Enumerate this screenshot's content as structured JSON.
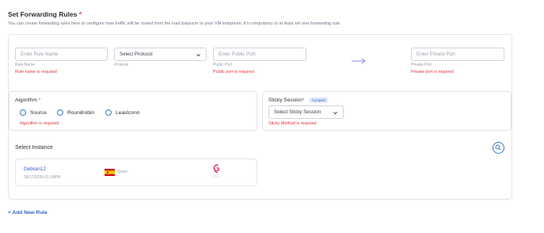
{
  "header": {
    "title": "Set Forwarding Rules",
    "required_mark": "*",
    "description": "You can create forwarding rules here to configure how traffic will be routed from the load balancer to your VM instances. It's compulsory to at least set one forwarding rule."
  },
  "rule": {
    "rule_name": {
      "placeholder": "Enter Rule Name",
      "label": "Rule Name",
      "error": "Rule name is required"
    },
    "protocol": {
      "value": "Select Protocol",
      "label": "Protocol"
    },
    "public_port": {
      "placeholder": "Enter Public Port",
      "label": "Public Port",
      "error": "Public port is required"
    },
    "private_port": {
      "placeholder": "Enter Private Port",
      "label": "Private Port",
      "error": "Private port is required"
    }
  },
  "algorithm": {
    "title": "Algorithm",
    "required_mark": "*",
    "options": [
      "Source",
      "Roundrobin",
      "Leastconn"
    ],
    "error": "Algorithm is required"
  },
  "sticky": {
    "title": "Sticky Session",
    "required_mark": "*",
    "badge": "Compare",
    "value": "Select Sticky Session",
    "error": "Sticky Method is required"
  },
  "instance": {
    "section_title": "Select Instance",
    "name": "Debian12",
    "date": "08/17/2024 01:34PM",
    "region": "Spain",
    "flag_icon": "spain-flag-icon",
    "os_icon": "debian-logo-icon"
  },
  "add_rule": "+ Add New Rule",
  "colors": {
    "accent": "#3c78c8",
    "error": "#e0383e",
    "arrow": "#9ba6f5"
  }
}
